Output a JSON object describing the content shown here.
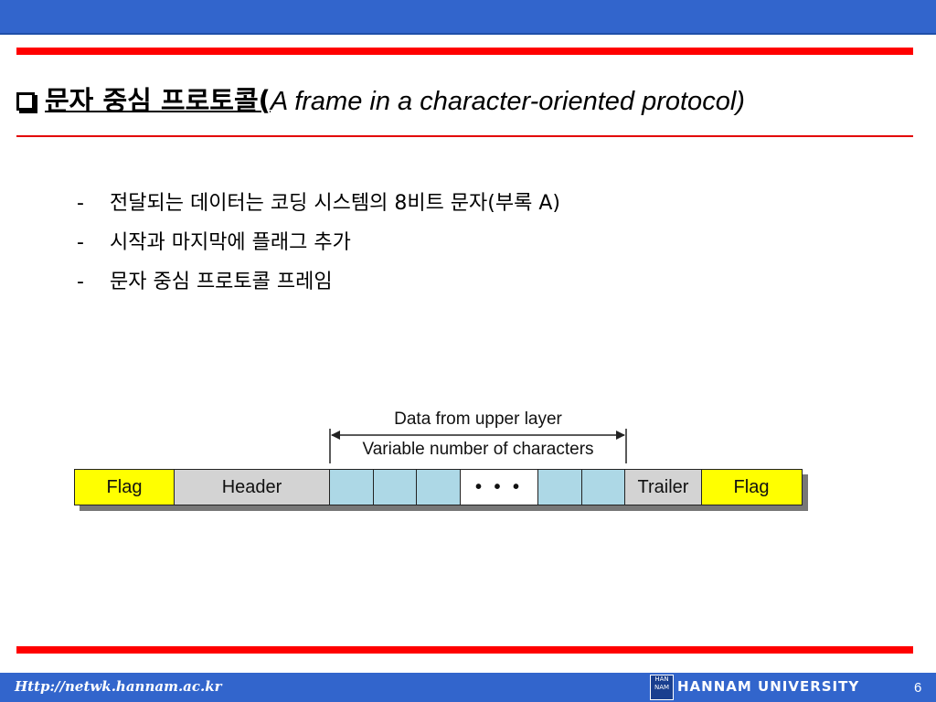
{
  "title": {
    "korean": "문자 중심 프로토콜(",
    "english": "A frame in a character-oriented protocol)"
  },
  "bullets": [
    "전달되는 데이터는 코딩 시스템의 8비트 문자(부록 A)",
    "시작과 마지막에 플래그 추가",
    "문자 중심 프로토콜 프레임"
  ],
  "bullet_marker": "-",
  "diagram": {
    "upper_label": "Data from upper layer",
    "lower_label": "Variable number of characters",
    "cells": [
      {
        "label": "Flag",
        "kind": "flag"
      },
      {
        "label": "Header",
        "kind": "gray"
      },
      {
        "label": "",
        "kind": "blue"
      },
      {
        "label": "",
        "kind": "blue"
      },
      {
        "label": "",
        "kind": "blue"
      },
      {
        "label": "• • •",
        "kind": "white"
      },
      {
        "label": "",
        "kind": "blue"
      },
      {
        "label": "",
        "kind": "blue"
      },
      {
        "label": "Trailer",
        "kind": "gray"
      },
      {
        "label": "Flag",
        "kind": "flag"
      }
    ]
  },
  "footer": {
    "url": "Http://netwk.hannam.ac.kr",
    "logo_text": "HAN NAM",
    "university": "HANNAM UNIVERSITY",
    "page": "6"
  },
  "colors": {
    "header_blue": "#3265cc",
    "accent_red": "#ff0000",
    "flag_yellow": "#ffff00",
    "data_blue": "#add8e6",
    "field_gray": "#d3d3d3"
  }
}
